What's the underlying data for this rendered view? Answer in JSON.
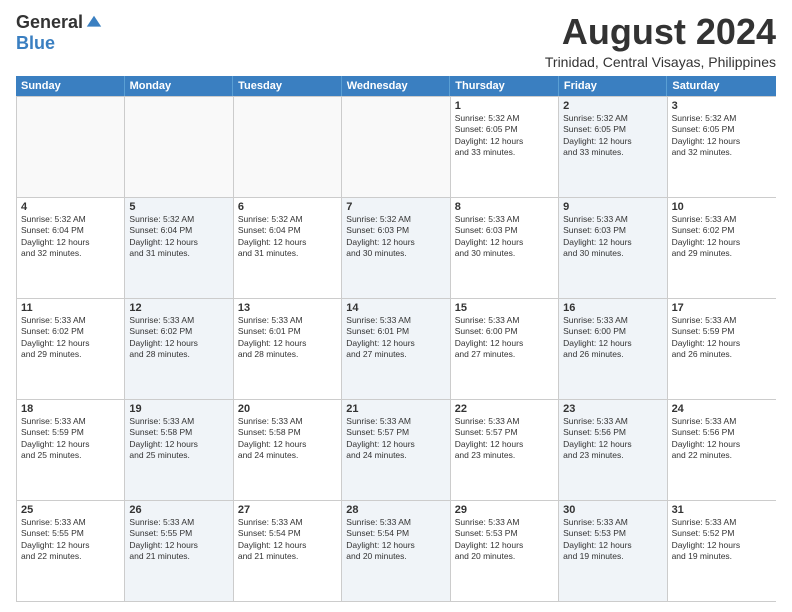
{
  "header": {
    "logo_general": "General",
    "logo_blue": "Blue",
    "month_year": "August 2024",
    "location": "Trinidad, Central Visayas, Philippines"
  },
  "weekdays": [
    "Sunday",
    "Monday",
    "Tuesday",
    "Wednesday",
    "Thursday",
    "Friday",
    "Saturday"
  ],
  "rows": [
    [
      {
        "day": "",
        "info": "",
        "shaded": false,
        "empty": true
      },
      {
        "day": "",
        "info": "",
        "shaded": false,
        "empty": true
      },
      {
        "day": "",
        "info": "",
        "shaded": false,
        "empty": true
      },
      {
        "day": "",
        "info": "",
        "shaded": false,
        "empty": true
      },
      {
        "day": "1",
        "info": "Sunrise: 5:32 AM\nSunset: 6:05 PM\nDaylight: 12 hours\nand 33 minutes.",
        "shaded": false,
        "empty": false
      },
      {
        "day": "2",
        "info": "Sunrise: 5:32 AM\nSunset: 6:05 PM\nDaylight: 12 hours\nand 33 minutes.",
        "shaded": true,
        "empty": false
      },
      {
        "day": "3",
        "info": "Sunrise: 5:32 AM\nSunset: 6:05 PM\nDaylight: 12 hours\nand 32 minutes.",
        "shaded": false,
        "empty": false
      }
    ],
    [
      {
        "day": "4",
        "info": "Sunrise: 5:32 AM\nSunset: 6:04 PM\nDaylight: 12 hours\nand 32 minutes.",
        "shaded": false,
        "empty": false
      },
      {
        "day": "5",
        "info": "Sunrise: 5:32 AM\nSunset: 6:04 PM\nDaylight: 12 hours\nand 31 minutes.",
        "shaded": true,
        "empty": false
      },
      {
        "day": "6",
        "info": "Sunrise: 5:32 AM\nSunset: 6:04 PM\nDaylight: 12 hours\nand 31 minutes.",
        "shaded": false,
        "empty": false
      },
      {
        "day": "7",
        "info": "Sunrise: 5:32 AM\nSunset: 6:03 PM\nDaylight: 12 hours\nand 30 minutes.",
        "shaded": true,
        "empty": false
      },
      {
        "day": "8",
        "info": "Sunrise: 5:33 AM\nSunset: 6:03 PM\nDaylight: 12 hours\nand 30 minutes.",
        "shaded": false,
        "empty": false
      },
      {
        "day": "9",
        "info": "Sunrise: 5:33 AM\nSunset: 6:03 PM\nDaylight: 12 hours\nand 30 minutes.",
        "shaded": true,
        "empty": false
      },
      {
        "day": "10",
        "info": "Sunrise: 5:33 AM\nSunset: 6:02 PM\nDaylight: 12 hours\nand 29 minutes.",
        "shaded": false,
        "empty": false
      }
    ],
    [
      {
        "day": "11",
        "info": "Sunrise: 5:33 AM\nSunset: 6:02 PM\nDaylight: 12 hours\nand 29 minutes.",
        "shaded": false,
        "empty": false
      },
      {
        "day": "12",
        "info": "Sunrise: 5:33 AM\nSunset: 6:02 PM\nDaylight: 12 hours\nand 28 minutes.",
        "shaded": true,
        "empty": false
      },
      {
        "day": "13",
        "info": "Sunrise: 5:33 AM\nSunset: 6:01 PM\nDaylight: 12 hours\nand 28 minutes.",
        "shaded": false,
        "empty": false
      },
      {
        "day": "14",
        "info": "Sunrise: 5:33 AM\nSunset: 6:01 PM\nDaylight: 12 hours\nand 27 minutes.",
        "shaded": true,
        "empty": false
      },
      {
        "day": "15",
        "info": "Sunrise: 5:33 AM\nSunset: 6:00 PM\nDaylight: 12 hours\nand 27 minutes.",
        "shaded": false,
        "empty": false
      },
      {
        "day": "16",
        "info": "Sunrise: 5:33 AM\nSunset: 6:00 PM\nDaylight: 12 hours\nand 26 minutes.",
        "shaded": true,
        "empty": false
      },
      {
        "day": "17",
        "info": "Sunrise: 5:33 AM\nSunset: 5:59 PM\nDaylight: 12 hours\nand 26 minutes.",
        "shaded": false,
        "empty": false
      }
    ],
    [
      {
        "day": "18",
        "info": "Sunrise: 5:33 AM\nSunset: 5:59 PM\nDaylight: 12 hours\nand 25 minutes.",
        "shaded": false,
        "empty": false
      },
      {
        "day": "19",
        "info": "Sunrise: 5:33 AM\nSunset: 5:58 PM\nDaylight: 12 hours\nand 25 minutes.",
        "shaded": true,
        "empty": false
      },
      {
        "day": "20",
        "info": "Sunrise: 5:33 AM\nSunset: 5:58 PM\nDaylight: 12 hours\nand 24 minutes.",
        "shaded": false,
        "empty": false
      },
      {
        "day": "21",
        "info": "Sunrise: 5:33 AM\nSunset: 5:57 PM\nDaylight: 12 hours\nand 24 minutes.",
        "shaded": true,
        "empty": false
      },
      {
        "day": "22",
        "info": "Sunrise: 5:33 AM\nSunset: 5:57 PM\nDaylight: 12 hours\nand 23 minutes.",
        "shaded": false,
        "empty": false
      },
      {
        "day": "23",
        "info": "Sunrise: 5:33 AM\nSunset: 5:56 PM\nDaylight: 12 hours\nand 23 minutes.",
        "shaded": true,
        "empty": false
      },
      {
        "day": "24",
        "info": "Sunrise: 5:33 AM\nSunset: 5:56 PM\nDaylight: 12 hours\nand 22 minutes.",
        "shaded": false,
        "empty": false
      }
    ],
    [
      {
        "day": "25",
        "info": "Sunrise: 5:33 AM\nSunset: 5:55 PM\nDaylight: 12 hours\nand 22 minutes.",
        "shaded": false,
        "empty": false
      },
      {
        "day": "26",
        "info": "Sunrise: 5:33 AM\nSunset: 5:55 PM\nDaylight: 12 hours\nand 21 minutes.",
        "shaded": true,
        "empty": false
      },
      {
        "day": "27",
        "info": "Sunrise: 5:33 AM\nSunset: 5:54 PM\nDaylight: 12 hours\nand 21 minutes.",
        "shaded": false,
        "empty": false
      },
      {
        "day": "28",
        "info": "Sunrise: 5:33 AM\nSunset: 5:54 PM\nDaylight: 12 hours\nand 20 minutes.",
        "shaded": true,
        "empty": false
      },
      {
        "day": "29",
        "info": "Sunrise: 5:33 AM\nSunset: 5:53 PM\nDaylight: 12 hours\nand 20 minutes.",
        "shaded": false,
        "empty": false
      },
      {
        "day": "30",
        "info": "Sunrise: 5:33 AM\nSunset: 5:53 PM\nDaylight: 12 hours\nand 19 minutes.",
        "shaded": true,
        "empty": false
      },
      {
        "day": "31",
        "info": "Sunrise: 5:33 AM\nSunset: 5:52 PM\nDaylight: 12 hours\nand 19 minutes.",
        "shaded": false,
        "empty": false
      }
    ]
  ]
}
